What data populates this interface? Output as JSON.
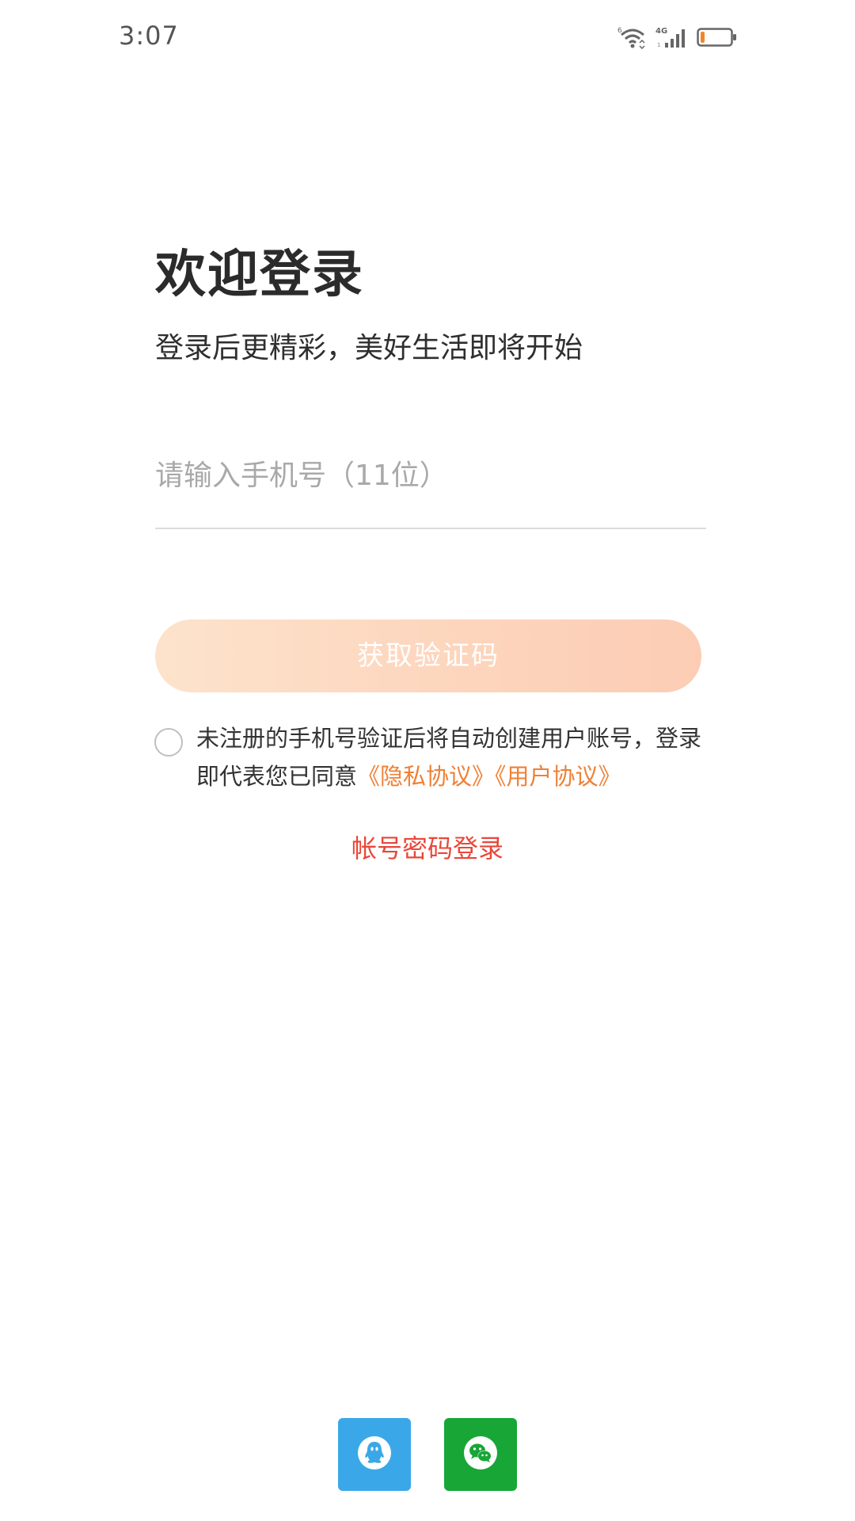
{
  "status_bar": {
    "time": "3:07",
    "wifi_icon": "wifi-6-icon",
    "network_label": "4G",
    "signal_icon": "signal-icon",
    "battery_icon": "battery-low-icon",
    "battery_level_fraction": 0.15,
    "battery_color": "#f0862a"
  },
  "login": {
    "title": "欢迎登录",
    "subtitle": "登录后更精彩，美好生活即将开始",
    "phone_placeholder": "请输入手机号（11位）",
    "phone_value": "",
    "get_code_label": "获取验证码",
    "agreement": {
      "checked": false,
      "text": "未注册的手机号验证后将自动创建用户账号，登录即代表您已同意",
      "privacy_link": "《隐私协议》",
      "user_link": "《用户协议》"
    },
    "account_login_label": "帐号密码登录"
  },
  "social": {
    "qq": {
      "icon": "qq-icon",
      "color": "#3aa8e8"
    },
    "wechat": {
      "icon": "wechat-icon",
      "color": "#18a637"
    }
  },
  "colors": {
    "accent_orange": "#f08035",
    "link_red": "#e8473a",
    "button_gradient_start": "#fde3cc",
    "button_gradient_end": "#fccdb4"
  }
}
